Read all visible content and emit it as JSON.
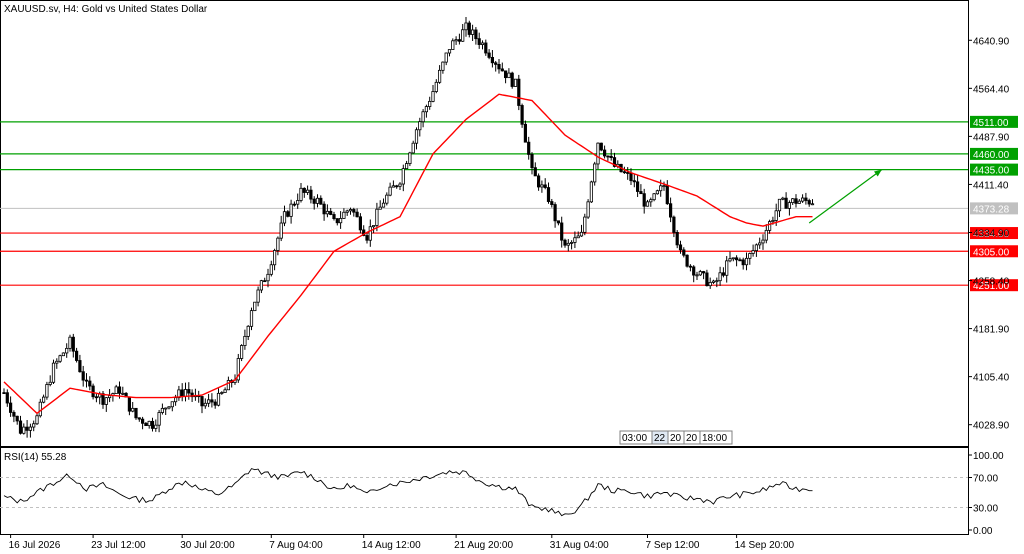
{
  "chart_data": [
    {
      "type": "candlestick",
      "title": "XAUUSD.sv, H4:  Gold vs United States Dollar",
      "ylim": [
        3995,
        4705
      ],
      "y_ticks": [
        4028.9,
        4105.4,
        4181.9,
        4258.4,
        4334.9,
        4411.4,
        4487.9,
        4564.4,
        4640.9
      ],
      "y_tick_labels": [
        "4028.90",
        "4105.40",
        "4181.90",
        "4258.40",
        "4334.90",
        "4411.40",
        "4487.90",
        "4564.40",
        "4640.90"
      ],
      "current_price": 4373.28,
      "current_price_label": "4373.28",
      "x_tick_labels": [
        "16 Jul 2026",
        "23 Jul 12:00",
        "30 Jul 20:00",
        "7 Aug 04:00",
        "14 Aug 12:00",
        "21 Aug 20:00",
        "31 Aug 04:00",
        "7 Sep 12:00",
        "14 Sep 20:00"
      ],
      "price_path_anchors": [
        [
          0,
          4080
        ],
        [
          5,
          4020
        ],
        [
          10,
          4040
        ],
        [
          15,
          4120
        ],
        [
          20,
          4160
        ],
        [
          25,
          4090
        ],
        [
          30,
          4070
        ],
        [
          35,
          4085
        ],
        [
          40,
          4040
        ],
        [
          45,
          4030
        ],
        [
          50,
          4065
        ],
        [
          55,
          4085
        ],
        [
          60,
          4060
        ],
        [
          65,
          4070
        ],
        [
          70,
          4105
        ],
        [
          75,
          4215
        ],
        [
          80,
          4275
        ],
        [
          85,
          4360
        ],
        [
          90,
          4400
        ],
        [
          95,
          4385
        ],
        [
          100,
          4350
        ],
        [
          105,
          4375
        ],
        [
          110,
          4330
        ],
        [
          115,
          4385
        ],
        [
          120,
          4420
        ],
        [
          125,
          4500
        ],
        [
          130,
          4560
        ],
        [
          135,
          4630
        ],
        [
          140,
          4660
        ],
        [
          145,
          4635
        ],
        [
          150,
          4600
        ],
        [
          155,
          4570
        ],
        [
          160,
          4430
        ],
        [
          165,
          4390
        ],
        [
          170,
          4310
        ],
        [
          175,
          4330
        ],
        [
          180,
          4480
        ],
        [
          185,
          4440
        ],
        [
          190,
          4420
        ],
        [
          195,
          4375
        ],
        [
          200,
          4410
        ],
        [
          205,
          4300
        ],
        [
          210,
          4270
        ],
        [
          215,
          4250
        ],
        [
          220,
          4290
        ],
        [
          225,
          4290
        ],
        [
          230,
          4330
        ],
        [
          235,
          4380
        ],
        [
          240,
          4385
        ]
      ],
      "moving_average_anchors": [
        [
          0,
          4097
        ],
        [
          10,
          4047
        ],
        [
          20,
          4087
        ],
        [
          30,
          4077
        ],
        [
          40,
          4072
        ],
        [
          50,
          4072
        ],
        [
          60,
          4076
        ],
        [
          70,
          4100
        ],
        [
          80,
          4170
        ],
        [
          90,
          4235
        ],
        [
          100,
          4305
        ],
        [
          110,
          4335
        ],
        [
          120,
          4360
        ],
        [
          130,
          4460
        ],
        [
          140,
          4515
        ],
        [
          150,
          4555
        ],
        [
          160,
          4545
        ],
        [
          170,
          4490
        ],
        [
          180,
          4455
        ],
        [
          190,
          4430
        ],
        [
          200,
          4412
        ],
        [
          210,
          4393
        ],
        [
          220,
          4360
        ],
        [
          225,
          4350
        ],
        [
          230,
          4345
        ],
        [
          240,
          4360
        ]
      ],
      "support_resistance_lines": [
        {
          "level": 4511.0,
          "label": "4511.00",
          "color": "#00a000"
        },
        {
          "level": 4460.0,
          "label": "4460.00",
          "color": "#00a000"
        },
        {
          "level": 4435.0,
          "label": "4435.00",
          "color": "#00a000"
        },
        {
          "level": 4334.0,
          "label": "4334.00",
          "color": "#ff0000"
        },
        {
          "level": 4305.0,
          "label": "4305.00",
          "color": "#ff0000"
        },
        {
          "level": 4251.0,
          "label": "4251.00",
          "color": "#ff0000"
        }
      ],
      "arrow": {
        "from": [
          244,
          4350
        ],
        "to": [
          266,
          4435
        ],
        "color": "#00a000"
      },
      "ma_color": "#ff0000",
      "grid": false
    },
    {
      "type": "line",
      "title": "RSI(14) 55.28",
      "ylim": [
        0,
        100
      ],
      "y_tick_labels": [
        "100.00",
        "70.00",
        "30.00",
        "0.00"
      ],
      "y_ticks": [
        100,
        70,
        30,
        0
      ],
      "levels": [
        70,
        30
      ],
      "rsi_anchors": [
        [
          0,
          44
        ],
        [
          5,
          38
        ],
        [
          10,
          50
        ],
        [
          15,
          63
        ],
        [
          20,
          73
        ],
        [
          25,
          55
        ],
        [
          30,
          60
        ],
        [
          35,
          48
        ],
        [
          40,
          41
        ],
        [
          45,
          40
        ],
        [
          50,
          56
        ],
        [
          55,
          65
        ],
        [
          60,
          53
        ],
        [
          65,
          48
        ],
        [
          70,
          60
        ],
        [
          75,
          82
        ],
        [
          80,
          74
        ],
        [
          85,
          70
        ],
        [
          90,
          78
        ],
        [
          95,
          68
        ],
        [
          100,
          53
        ],
        [
          105,
          60
        ],
        [
          110,
          47
        ],
        [
          115,
          60
        ],
        [
          120,
          63
        ],
        [
          125,
          68
        ],
        [
          130,
          73
        ],
        [
          135,
          78
        ],
        [
          140,
          77
        ],
        [
          145,
          64
        ],
        [
          150,
          58
        ],
        [
          155,
          55
        ],
        [
          160,
          30
        ],
        [
          165,
          28
        ],
        [
          170,
          18
        ],
        [
          175,
          32
        ],
        [
          180,
          60
        ],
        [
          185,
          52
        ],
        [
          190,
          52
        ],
        [
          195,
          45
        ],
        [
          200,
          50
        ],
        [
          205,
          43
        ],
        [
          210,
          42
        ],
        [
          215,
          38
        ],
        [
          220,
          45
        ],
        [
          225,
          48
        ],
        [
          230,
          53
        ],
        [
          235,
          62
        ],
        [
          240,
          55
        ]
      ],
      "color": "#000000"
    }
  ],
  "scroll_labels": [
    "03:00",
    "22",
    "20",
    "20",
    "18:00"
  ]
}
